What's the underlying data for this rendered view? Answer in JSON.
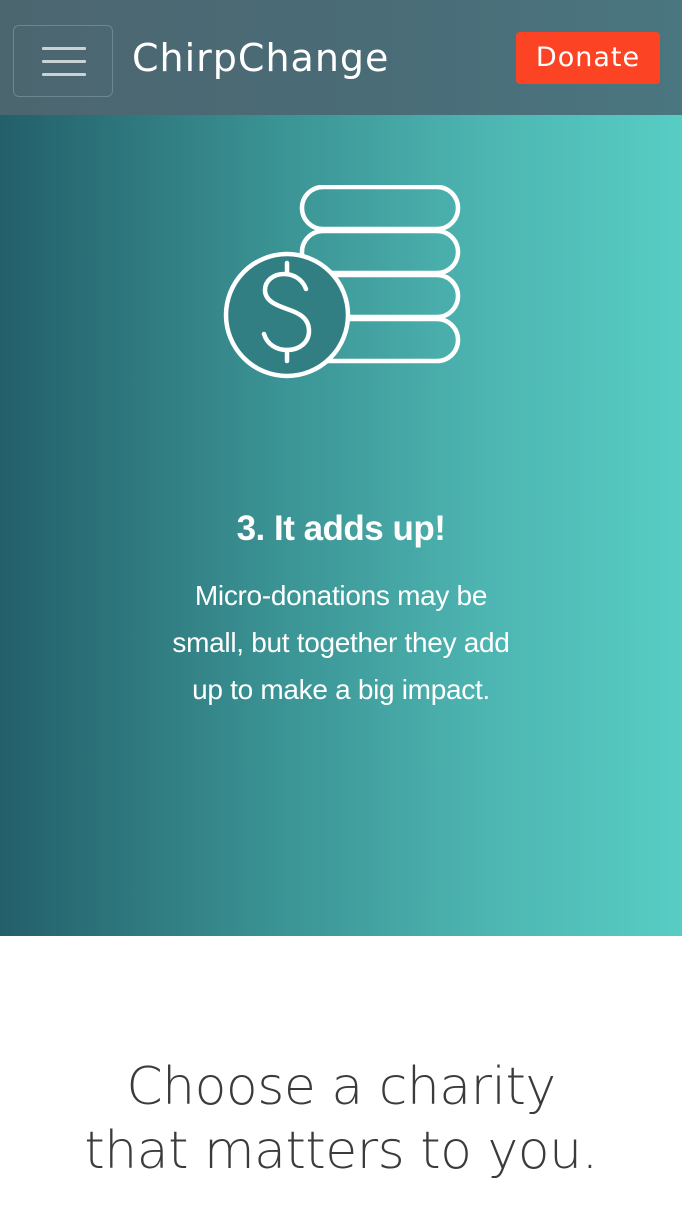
{
  "navbar": {
    "brand": "ChirpChange",
    "donate_label": "Donate",
    "menu_icon": "hamburger-menu-icon"
  },
  "hero": {
    "icon": "coins-dollar-icon",
    "step_title": "3. It adds up!",
    "step_body": "Micro-donations may be small, but together they add up to make a big impact."
  },
  "charity_section": {
    "heading_line1": "Choose a charity",
    "heading_line2": "that matters to you."
  },
  "colors": {
    "donate": "#fc4425",
    "navbar": "#4a6c77",
    "hero_start": "#235f6a",
    "hero_end": "#57cdc4",
    "heading_text": "#3b3b3b"
  }
}
